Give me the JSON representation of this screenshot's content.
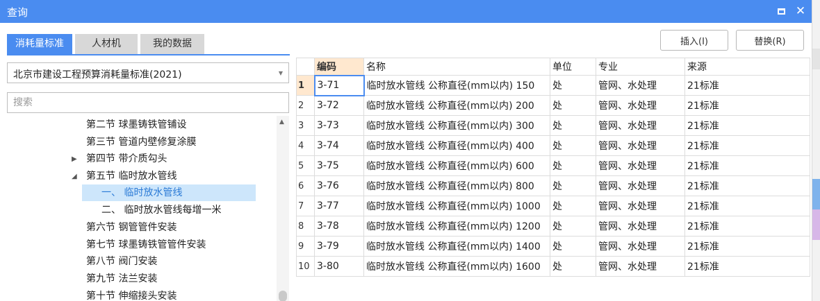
{
  "window": {
    "title": "查询",
    "close_glyph": "✕"
  },
  "tabs": [
    {
      "label": "消耗量标准",
      "active": true
    },
    {
      "label": "人材机",
      "active": false
    },
    {
      "label": "我的数据",
      "active": false
    }
  ],
  "toolbar": {
    "insert_label": "插入(I)",
    "replace_label": "替换(R)"
  },
  "standard_select": {
    "value": "北京市建设工程预算消耗量标准(2021)"
  },
  "search": {
    "placeholder": "搜索",
    "value": ""
  },
  "tree": {
    "items": [
      {
        "label": "第二节 球墨铸铁管铺设",
        "level": 0,
        "arrow": ""
      },
      {
        "label": "第三节 管道内壁修复涂膜",
        "level": 0,
        "arrow": ""
      },
      {
        "label": "第四节 带介质勾头",
        "level": 0,
        "arrow": "▶"
      },
      {
        "label": "第五节 临时放水管线",
        "level": 0,
        "arrow": "◢"
      },
      {
        "label": "一、 临时放水管线",
        "level": 1,
        "arrow": "",
        "selected": true
      },
      {
        "label": "二、 临时放水管线每增一米",
        "level": 1,
        "arrow": ""
      },
      {
        "label": "第六节 钢管管件安装",
        "level": 0,
        "arrow": ""
      },
      {
        "label": "第七节 球墨铸铁管管件安装",
        "level": 0,
        "arrow": ""
      },
      {
        "label": "第八节 阀门安装",
        "level": 0,
        "arrow": ""
      },
      {
        "label": "第九节 法兰安装",
        "level": 0,
        "arrow": ""
      },
      {
        "label": "第十节 伸缩接头安装",
        "level": 0,
        "arrow": ""
      }
    ]
  },
  "grid": {
    "headers": {
      "code": "编码",
      "name": "名称",
      "unit": "单位",
      "spec": "专业",
      "source": "来源"
    },
    "rows": [
      {
        "index": "1",
        "code": "3-71",
        "name": "临时放水管线 公称直径(mm以内) 150",
        "unit": "处",
        "spec": "管网、水处理",
        "source": "21标准"
      },
      {
        "index": "2",
        "code": "3-72",
        "name": "临时放水管线 公称直径(mm以内) 200",
        "unit": "处",
        "spec": "管网、水处理",
        "source": "21标准"
      },
      {
        "index": "3",
        "code": "3-73",
        "name": "临时放水管线 公称直径(mm以内) 300",
        "unit": "处",
        "spec": "管网、水处理",
        "source": "21标准"
      },
      {
        "index": "4",
        "code": "3-74",
        "name": "临时放水管线 公称直径(mm以内) 400",
        "unit": "处",
        "spec": "管网、水处理",
        "source": "21标准"
      },
      {
        "index": "5",
        "code": "3-75",
        "name": "临时放水管线 公称直径(mm以内) 600",
        "unit": "处",
        "spec": "管网、水处理",
        "source": "21标准"
      },
      {
        "index": "6",
        "code": "3-76",
        "name": "临时放水管线 公称直径(mm以内) 800",
        "unit": "处",
        "spec": "管网、水处理",
        "source": "21标准"
      },
      {
        "index": "7",
        "code": "3-77",
        "name": "临时放水管线 公称直径(mm以内) 1000",
        "unit": "处",
        "spec": "管网、水处理",
        "source": "21标准"
      },
      {
        "index": "8",
        "code": "3-78",
        "name": "临时放水管线 公称直径(mm以内) 1200",
        "unit": "处",
        "spec": "管网、水处理",
        "source": "21标准"
      },
      {
        "index": "9",
        "code": "3-79",
        "name": "临时放水管线 公称直径(mm以内) 1400",
        "unit": "处",
        "spec": "管网、水处理",
        "source": "21标准"
      },
      {
        "index": "10",
        "code": "3-80",
        "name": "临时放水管线 公称直径(mm以内) 1600",
        "unit": "处",
        "spec": "管网、水处理",
        "source": "21标准"
      }
    ]
  },
  "colors": {
    "accent": "#4a8cf0",
    "header_highlight": "#ffe8cf",
    "tree_selected": "#cde6fb"
  }
}
